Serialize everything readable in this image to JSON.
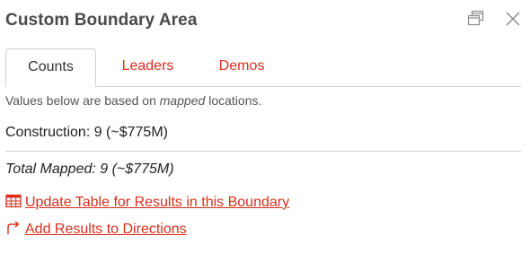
{
  "panel": {
    "title": "Custom Boundary Area"
  },
  "tabs": [
    {
      "label": "Counts",
      "active": true
    },
    {
      "label": "Leaders",
      "active": false
    },
    {
      "label": "Demos",
      "active": false
    }
  ],
  "note": {
    "prefix": "Values below are based on ",
    "emphasis": "mapped",
    "suffix": " locations."
  },
  "counts": {
    "construction": "Construction: 9 (~$775M)",
    "total": "Total Mapped: 9 (~$775M)"
  },
  "actions": {
    "update_table": "Update Table for Results in this Boundary",
    "add_directions": "Add Results to Directions"
  },
  "colors": {
    "accent": "#d9301c",
    "text": "#333333",
    "divider": "#cfcfcf"
  },
  "icons": {
    "popout": "popout-window-icon",
    "close": "close-icon",
    "table": "table-icon",
    "directions": "turn-right-arrow-icon"
  }
}
